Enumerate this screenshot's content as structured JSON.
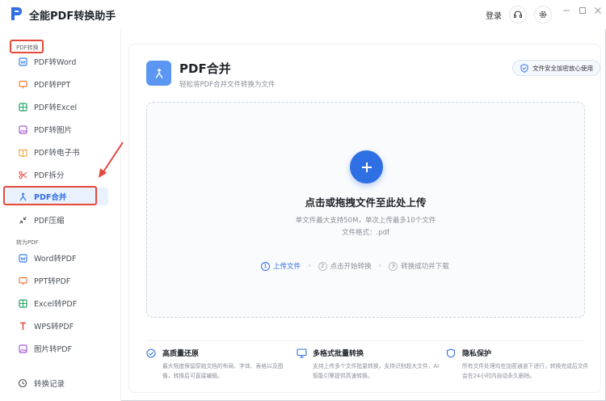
{
  "app": {
    "title": "全能PDF转换助手",
    "login_label": "登录"
  },
  "sidebar": {
    "section_pdf_convert": "PDF转换",
    "section_to_pdf": "转为PDF",
    "items_from_pdf": [
      {
        "label": "PDF转Word",
        "icon": "word-icon",
        "color": "#3b7ef0"
      },
      {
        "label": "PDF转PPT",
        "icon": "ppt-icon",
        "color": "#f07c3b"
      },
      {
        "label": "PDF转Excel",
        "icon": "excel-icon",
        "color": "#21a366"
      },
      {
        "label": "PDF转图片",
        "icon": "image-icon",
        "color": "#a55ad8"
      },
      {
        "label": "PDF转电子书",
        "icon": "book-icon",
        "color": "#f0a23b"
      },
      {
        "label": "PDF拆分",
        "icon": "scissors-icon",
        "color": "#e5483c"
      },
      {
        "label": "PDF合并",
        "icon": "merge-icon",
        "color": "#2f6fe4"
      },
      {
        "label": "PDF压缩",
        "icon": "compress-icon",
        "color": "#4a4f57"
      }
    ],
    "items_to_pdf": [
      {
        "label": "Word转PDF",
        "icon": "word-icon",
        "color": "#3b7ef0"
      },
      {
        "label": "PPT转PDF",
        "icon": "ppt-icon",
        "color": "#f07c3b"
      },
      {
        "label": "Excel转PDF",
        "icon": "excel-icon",
        "color": "#21a366"
      },
      {
        "label": "WPS转PDF",
        "icon": "wps-icon",
        "color": "#e5483c"
      },
      {
        "label": "图片转PDF",
        "icon": "image-icon",
        "color": "#a55ad8"
      }
    ],
    "history_label": "转换记录"
  },
  "main": {
    "title": "PDF合并",
    "subtitle": "轻松将PDF合并文件转换为文件",
    "security_badge": "文件安全加密放心使用",
    "dropzone": {
      "title": "点击或拖拽文件至此处上传",
      "info_line1": "单文件最大支持50M，单次上传最多10个文件",
      "info_line2": "文件格式：.pdf"
    },
    "steps": [
      {
        "num": "1",
        "label": "上传文件"
      },
      {
        "num": "2",
        "label": "点击开始转换"
      },
      {
        "num": "3",
        "label": "转换成功并下载"
      }
    ],
    "features": [
      {
        "title": "高质量还原",
        "desc": "最大限度保留原始文档的布局、字体、表格以及图像，转换后可直接编辑。"
      },
      {
        "title": "多格式批量转换",
        "desc": "支持上传多个文件批量转换，支持识别超大文件，AI智能引擎提供高速转换。"
      },
      {
        "title": "隐私保护",
        "desc": "所有文件处理均在加密通道下进行，转换完成后文件会在24小时内自动永久删除。"
      }
    ]
  },
  "colors": {
    "accent": "#2f6fe4",
    "annotation_red": "#e5483c"
  }
}
